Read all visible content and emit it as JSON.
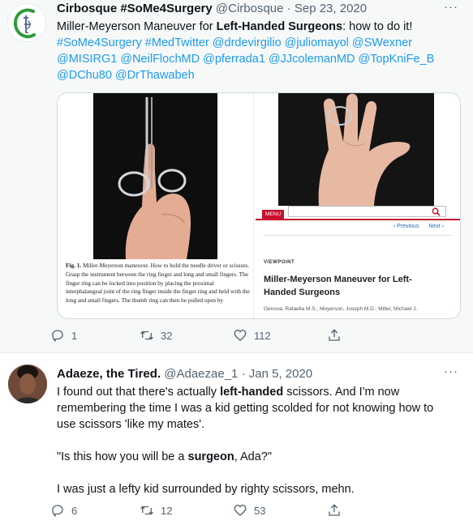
{
  "tweet1": {
    "name": "Cirbosque #SoMe4Surgery",
    "handle": "@Cirbosque",
    "separator": "·",
    "date": "Sep 23, 2020",
    "text_pre": "Miller-Meyerson Maneuver for ",
    "text_bold": "Left-Handed Surgeons",
    "text_post": ": how to do it!",
    "links_line1": "#SoMe4Surgery #MedTwitter @drdevirgilio @juliomayol @SWexner",
    "links_line2": "@MISIRG1 @NeilFlochMD @pferrada1 @JJcolemanMD @TopKniFe_B",
    "links_line3": "@DChu80 @DrThawabeh",
    "media": {
      "caption_label": "Fig. 1.",
      "caption_text": " Miller-Meyerson maneuver. How to hold the needle driver or scissors. Grasp the instrument between the ring finger and long and small fingers. The finger ring can be locked into position by placing the proximal interphalangeal joint of the ring finger inside the finger ring and held with the long and small fingers. The thumb ring can then be pulled open by",
      "menu_label": "MENU",
      "nav_prev": "‹ Previous",
      "nav_next": "Next ›",
      "viewpoint": "VIEWPOINT",
      "article_title": "Miller-Meyerson Maneuver for Left-Handed Surgeons",
      "authors": "Genova, Rafaella M.S.; Meyerson, Joseph M.D.; Miller, Michael J."
    },
    "replies": "1",
    "retweets": "32",
    "likes": "112"
  },
  "tweet2": {
    "name": "Adaeze, the Tired.",
    "handle": "@Adaezae_1",
    "separator": "·",
    "date": "Jan 5, 2020",
    "p1_pre": "I found out that there's actually ",
    "p1_bold": "left-handed",
    "p1_post": " scissors. And I'm now",
    "p1_line2": "remembering the time I was a kid getting scolded for not knowing how to",
    "p1_line3": "use scissors 'like my mates'.",
    "p2_pre": "\"Is this how you will be a ",
    "p2_bold": "surgeon",
    "p2_post": ", Ada?\"",
    "p3": "I was just a lefty kid surrounded by righty scissors, mehn.",
    "replies": "6",
    "retweets": "12",
    "likes": "53"
  },
  "more_label": "···",
  "colors": {
    "link": "#1d9bf0",
    "muted": "#536471",
    "text": "#0f1419",
    "logo_green": "#2e9b3a",
    "journal_red": "#c8102e"
  }
}
